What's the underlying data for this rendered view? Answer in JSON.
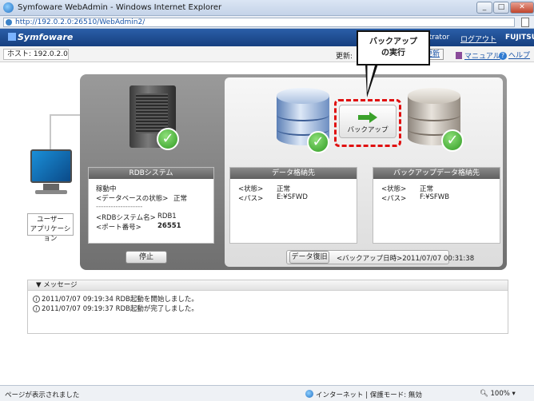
{
  "window": {
    "title": "Symfoware WebAdmin - Windows Internet Explorer",
    "url": "http://192.0.2.0:26510/WebAdmin2/"
  },
  "header": {
    "brand": "Symfoware",
    "user": "strator",
    "logout": "ログアウト",
    "vendor": "FUJITSU"
  },
  "toolbar": {
    "host": "ホスト: 192.0.2.0",
    "update_label": "更新:",
    "update_button": "更新",
    "manual": "マニュアル",
    "help": "ヘルプ"
  },
  "callout": {
    "line1": "バックアップ",
    "line2": "の実行"
  },
  "client": {
    "line1": "ユーザー",
    "line2": "アプリケーション"
  },
  "rdb": {
    "title": "RDBシステム",
    "status": "稼動中",
    "db_state_label": "<データベースの状態>",
    "db_state_value": "正常",
    "separator": "-------------------",
    "system_name_label": "<RDBシステム名>",
    "system_name_value": "RDB1",
    "port_label": "<ポート番号>",
    "port_value": "26551",
    "stop_button": "停止"
  },
  "backup_button": "バックアップ",
  "data_store": {
    "title": "データ格納先",
    "state_label": "<状態>",
    "state_value": "正常",
    "path_label": "<パス>",
    "path_value": "E:¥SFWD"
  },
  "backup_store": {
    "title": "バックアップデータ格納先",
    "state_label": "<状態>",
    "state_value": "正常",
    "path_label": "<パス>",
    "path_value": "F:¥SFWB"
  },
  "restore": {
    "button": "データ復旧",
    "last_backup": "<バックアップ日時>2011/07/07 00:31:38"
  },
  "messages": {
    "header": "▼ メッセージ",
    "items": [
      "2011/07/07 09:19:34 RDB起動を開始しました。",
      "2011/07/07 09:19:37 RDB起動が完了しました。"
    ]
  },
  "status": {
    "left": "ページが表示されました",
    "zone": "インターネット | 保護モード: 無効",
    "zoom": "100%"
  }
}
